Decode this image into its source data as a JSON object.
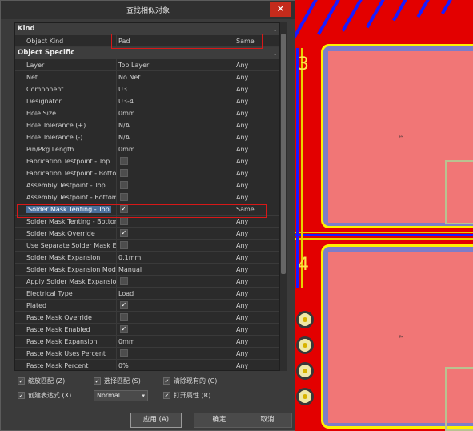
{
  "dialog": {
    "title": "查找相似对象",
    "close_glyph": "✕"
  },
  "sections": {
    "kind": {
      "title": "Kind",
      "chevron": "⌄"
    },
    "object_specific": {
      "title": "Object Specific",
      "chevron": "⌄"
    }
  },
  "kind_row": {
    "label": "Object Kind",
    "value": "Pad",
    "mode": "Same"
  },
  "rows": [
    {
      "label": "Layer",
      "value": "Top Layer",
      "mode": "Any",
      "type": "text"
    },
    {
      "label": "Net",
      "value": "No Net",
      "mode": "Any",
      "type": "text"
    },
    {
      "label": "Component",
      "value": "U3",
      "mode": "Any",
      "type": "text"
    },
    {
      "label": "Designator",
      "value": "U3-4",
      "mode": "Any",
      "type": "text"
    },
    {
      "label": "Hole Size",
      "value": "0mm",
      "mode": "Any",
      "type": "text"
    },
    {
      "label": "Hole Tolerance (+)",
      "value": "N/A",
      "mode": "Any",
      "type": "text"
    },
    {
      "label": "Hole Tolerance (-)",
      "value": "N/A",
      "mode": "Any",
      "type": "text"
    },
    {
      "label": "Pin/Pkg Length",
      "value": "0mm",
      "mode": "Any",
      "type": "text"
    },
    {
      "label": "Fabrication Testpoint - Top",
      "value": "",
      "mode": "Any",
      "type": "check",
      "checked": false
    },
    {
      "label": "Fabrication Testpoint - Bottom",
      "value": "",
      "mode": "Any",
      "type": "check",
      "checked": false
    },
    {
      "label": "Assembly Testpoint - Top",
      "value": "",
      "mode": "Any",
      "type": "check",
      "checked": false
    },
    {
      "label": "Assembly Testpoint - Bottom",
      "value": "",
      "mode": "Any",
      "type": "check",
      "checked": false
    },
    {
      "label": "Solder Mask Tenting - Top",
      "value": "",
      "mode": "Same",
      "type": "check",
      "checked": true,
      "selected": true
    },
    {
      "label": "Solder Mask Tenting - Bottom",
      "value": "",
      "mode": "Any",
      "type": "check",
      "checked": false
    },
    {
      "label": "Solder Mask Override",
      "value": "",
      "mode": "Any",
      "type": "check",
      "checked": true
    },
    {
      "label": "Use Separate Solder Mask Expa",
      "value": "",
      "mode": "Any",
      "type": "check",
      "checked": false
    },
    {
      "label": "Solder Mask Expansion",
      "value": "0.1mm",
      "mode": "Any",
      "type": "text"
    },
    {
      "label": "Solder Mask Expansion Mode",
      "value": "Manual",
      "mode": "Any",
      "type": "text"
    },
    {
      "label": "Apply Solder Mask Expansion F",
      "value": "",
      "mode": "Any",
      "type": "check",
      "checked": false
    },
    {
      "label": "Electrical Type",
      "value": "Load",
      "mode": "Any",
      "type": "text"
    },
    {
      "label": "Plated",
      "value": "",
      "mode": "Any",
      "type": "check",
      "checked": true
    },
    {
      "label": "Paste Mask Override",
      "value": "",
      "mode": "Any",
      "type": "check",
      "checked": false
    },
    {
      "label": "Paste Mask Enabled",
      "value": "",
      "mode": "Any",
      "type": "check",
      "checked": true
    },
    {
      "label": "Paste Mask Expansion",
      "value": "0mm",
      "mode": "Any",
      "type": "text"
    },
    {
      "label": "Paste Mask Uses Percent",
      "value": "",
      "mode": "Any",
      "type": "check",
      "checked": false
    },
    {
      "label": "Paste Mask Percent",
      "value": "0%",
      "mode": "Any",
      "type": "text"
    }
  ],
  "options": {
    "zoom_matching": {
      "label": "缩放匹配 (Z)",
      "checked": true
    },
    "select_matching": {
      "label": "选择匹配 (S)",
      "checked": true
    },
    "clear_existing": {
      "label": "清除现有的 (C)",
      "checked": true
    },
    "create_expression": {
      "label": "创建表达式 (X)",
      "checked": true
    },
    "open_properties": {
      "label": "打开属性 (R)",
      "checked": true
    },
    "mask_mode": "Normal",
    "check_glyph": "✓",
    "dropdown_glyph": "▾"
  },
  "buttons": {
    "apply": "应用 (A)",
    "ok": "确定",
    "cancel": "取消"
  },
  "pcb": {
    "pad_number_top": "3",
    "pad_number_bottom": "4",
    "pad_small_label": "4"
  }
}
